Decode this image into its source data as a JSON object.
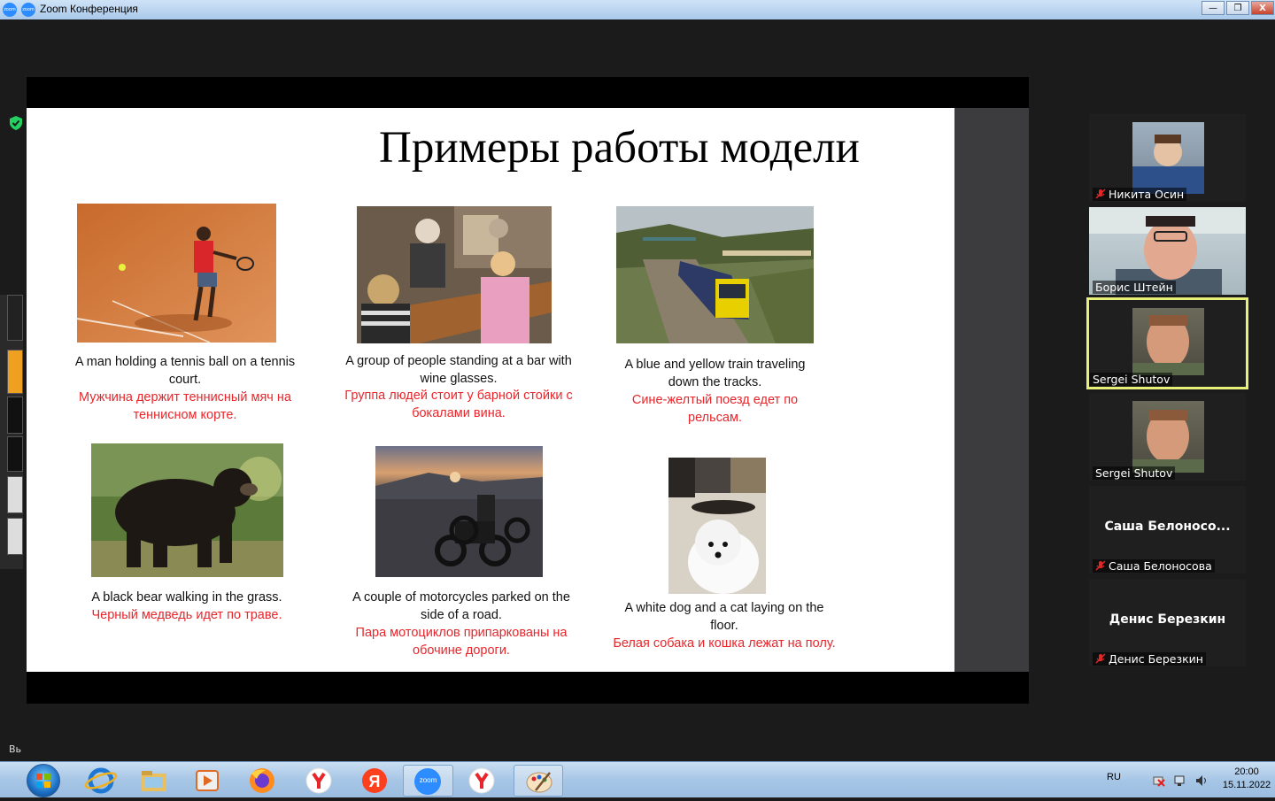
{
  "window": {
    "title": "Zoom Конференция",
    "icon1": "zoom-logo-icon",
    "icon2_partial": "Z",
    "controls": {
      "minimize": "—",
      "maximize": "❐",
      "close": "X"
    }
  },
  "slide": {
    "title": "Примеры работы модели",
    "examples": [
      {
        "en": "A man holding a tennis ball on a tennis court.",
        "ru": "Мужчина держит теннисный мяч на теннисном корте.",
        "photo": "tennis-player"
      },
      {
        "en": "A group of people standing at a bar with wine glasses.",
        "ru": "Группа людей стоит у барной стойки с бокалами вина.",
        "photo": "bar-group"
      },
      {
        "en": "A blue and yellow train traveling down the tracks.",
        "ru": "Сине-желтый поезд едет по рельсам.",
        "photo": "train"
      },
      {
        "en": "A black bear walking in the grass.",
        "ru": "Черный медведь идет по траве.",
        "photo": "black-bear"
      },
      {
        "en": "A couple of motorcycles parked on the side of a road.",
        "ru": "Пара мотоциклов припаркованы на обочине дороги.",
        "photo": "motorcycles"
      },
      {
        "en": "A white dog and a cat laying on the floor.",
        "ru": "Белая собака и кошка лежат на полу.",
        "photo": "dog-and-cat"
      }
    ]
  },
  "participants": [
    {
      "name": "Никита Осин",
      "muted": true,
      "video": true
    },
    {
      "name": "Борис Штейн",
      "muted": false,
      "video": true
    },
    {
      "name": "Sergei Shutov",
      "muted": false,
      "video": true,
      "speaking": true
    },
    {
      "name": "Sergei Shutov",
      "muted": false,
      "video": true
    },
    {
      "name": "Саша Белоносова",
      "display": "Саша  Белоносо...",
      "muted": true,
      "video": false
    },
    {
      "name": "Денис Березкин",
      "display": "Денис Березкин",
      "muted": true,
      "video": false
    }
  ],
  "misc": {
    "partial_label": "Вь"
  },
  "taskbar": {
    "apps": [
      "internet-explorer-icon",
      "file-explorer-icon",
      "media-player-icon",
      "firefox-icon",
      "yandex-browser-icon",
      "yandex-icon",
      "zoom-icon",
      "yandex-browser-icon",
      "paint-icon"
    ],
    "zoom_label": "zoom",
    "lang": "RU",
    "time": "20:00",
    "date": "15.11.2022"
  },
  "colors": {
    "caption_ru": "#e8262b",
    "active_speaker_border": "#e7ef7a",
    "zoom_blue": "#2d8cff"
  }
}
